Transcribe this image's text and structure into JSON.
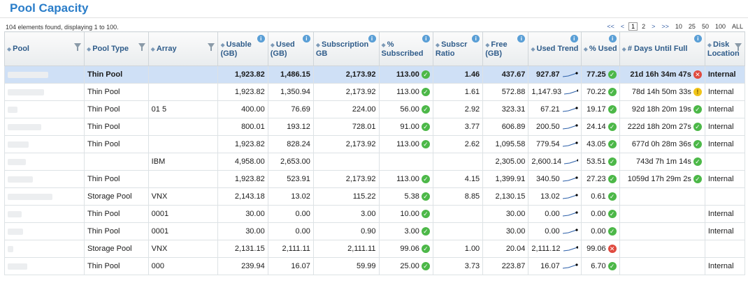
{
  "page": {
    "title": "Pool Capacity",
    "count_text": "104 elements found, displaying 1 to 100."
  },
  "pager": {
    "first": "<<",
    "prev": "<",
    "pages": [
      "1",
      "2"
    ],
    "next": ">",
    "last": ">>",
    "sizes": [
      "10",
      "25",
      "50",
      "100",
      "ALL"
    ]
  },
  "columns": {
    "pool": "Pool",
    "pool_type": "Pool Type",
    "array": "Array",
    "usable": "Usable (GB)",
    "used": "Used (GB)",
    "subscription": "Subscription GB",
    "pct_subscribed": "% Subscribed",
    "subscr_ratio": "Subscr Ratio",
    "free": "Free (GB)",
    "used_trend": "Used Trend",
    "pct_used": "% Used",
    "days_until_full": "# Days Until Full",
    "disk_location": "Disk Location"
  },
  "rows": [
    {
      "type": "Thin Pool",
      "array": "",
      "usable": "1,923.82",
      "used": "1,486.15",
      "subscription": "2,173.92",
      "pct_sub": "113.00",
      "pct_sub_status": "ok",
      "ratio": "1.46",
      "free": "437.67",
      "trend": "927.87",
      "pct_used": "77.25",
      "pct_used_status": "ok",
      "days": "21d 16h 34m 47s",
      "days_status": "bad",
      "loc": "Internal"
    },
    {
      "type": "Thin Pool",
      "array": "",
      "usable": "1,923.82",
      "used": "1,350.94",
      "subscription": "2,173.92",
      "pct_sub": "113.00",
      "pct_sub_status": "ok",
      "ratio": "1.61",
      "free": "572.88",
      "trend": "1,147.93",
      "pct_used": "70.22",
      "pct_used_status": "ok",
      "days": "78d 14h 50m 33s",
      "days_status": "warn",
      "loc": "Internal"
    },
    {
      "type": "Thin Pool",
      "array": "01 5",
      "usable": "400.00",
      "used": "76.69",
      "subscription": "224.00",
      "pct_sub": "56.00",
      "pct_sub_status": "ok",
      "ratio": "2.92",
      "free": "323.31",
      "trend": "67.21",
      "pct_used": "19.17",
      "pct_used_status": "ok",
      "days": "92d 18h 20m 19s",
      "days_status": "ok",
      "loc": "Internal"
    },
    {
      "type": "Thin Pool",
      "array": "",
      "usable": "800.01",
      "used": "193.12",
      "subscription": "728.01",
      "pct_sub": "91.00",
      "pct_sub_status": "ok",
      "ratio": "3.77",
      "free": "606.89",
      "trend": "200.50",
      "pct_used": "24.14",
      "pct_used_status": "ok",
      "days": "222d 18h 20m 27s",
      "days_status": "ok",
      "loc": "Internal"
    },
    {
      "type": "Thin Pool",
      "array": "",
      "usable": "1,923.82",
      "used": "828.24",
      "subscription": "2,173.92",
      "pct_sub": "113.00",
      "pct_sub_status": "ok",
      "ratio": "2.62",
      "free": "1,095.58",
      "trend": "779.54",
      "pct_used": "43.05",
      "pct_used_status": "ok",
      "days": "677d 0h 28m 36s",
      "days_status": "ok",
      "loc": "Internal"
    },
    {
      "type": "",
      "array": "IBM",
      "usable": "4,958.00",
      "used": "2,653.00",
      "subscription": "",
      "pct_sub": "",
      "pct_sub_status": "",
      "ratio": "",
      "free": "2,305.00",
      "trend": "2,600.14",
      "pct_used": "53.51",
      "pct_used_status": "ok",
      "days": "743d 7h 1m 14s",
      "days_status": "ok",
      "loc": ""
    },
    {
      "type": "Thin Pool",
      "array": "",
      "usable": "1,923.82",
      "used": "523.91",
      "subscription": "2,173.92",
      "pct_sub": "113.00",
      "pct_sub_status": "ok",
      "ratio": "4.15",
      "free": "1,399.91",
      "trend": "340.50",
      "pct_used": "27.23",
      "pct_used_status": "ok",
      "days": "1059d 17h 29m 2s",
      "days_status": "ok",
      "loc": "Internal"
    },
    {
      "type": "Storage Pool",
      "array": "VNX",
      "usable": "2,143.18",
      "used": "13.02",
      "subscription": "115.22",
      "pct_sub": "5.38",
      "pct_sub_status": "ok",
      "ratio": "8.85",
      "free": "2,130.15",
      "trend": "13.02",
      "pct_used": "0.61",
      "pct_used_status": "ok",
      "days": "",
      "days_status": "",
      "loc": ""
    },
    {
      "type": "Thin Pool",
      "array": "0001",
      "usable": "30.00",
      "used": "0.00",
      "subscription": "3.00",
      "pct_sub": "10.00",
      "pct_sub_status": "ok",
      "ratio": "",
      "free": "30.00",
      "trend": "0.00",
      "pct_used": "0.00",
      "pct_used_status": "ok",
      "days": "",
      "days_status": "",
      "loc": "Internal"
    },
    {
      "type": "Thin Pool",
      "array": "0001",
      "usable": "30.00",
      "used": "0.00",
      "subscription": "0.90",
      "pct_sub": "3.00",
      "pct_sub_status": "ok",
      "ratio": "",
      "free": "30.00",
      "trend": "0.00",
      "pct_used": "0.00",
      "pct_used_status": "ok",
      "days": "",
      "days_status": "",
      "loc": "Internal"
    },
    {
      "type": "Storage Pool",
      "array": "VNX",
      "usable": "2,131.15",
      "used": "2,111.11",
      "subscription": "2,111.11",
      "pct_sub": "99.06",
      "pct_sub_status": "ok",
      "ratio": "1.00",
      "free": "20.04",
      "trend": "2,111.12",
      "pct_used": "99.06",
      "pct_used_status": "bad",
      "days": "",
      "days_status": "",
      "loc": ""
    },
    {
      "type": "Thin Pool",
      "array": "000",
      "usable": "239.94",
      "used": "16.07",
      "subscription": "59.99",
      "pct_sub": "25.00",
      "pct_sub_status": "ok",
      "ratio": "3.73",
      "free": "223.87",
      "trend": "16.07",
      "pct_used": "6.70",
      "pct_used_status": "ok",
      "days": "",
      "days_status": "",
      "loc": "Internal"
    }
  ]
}
